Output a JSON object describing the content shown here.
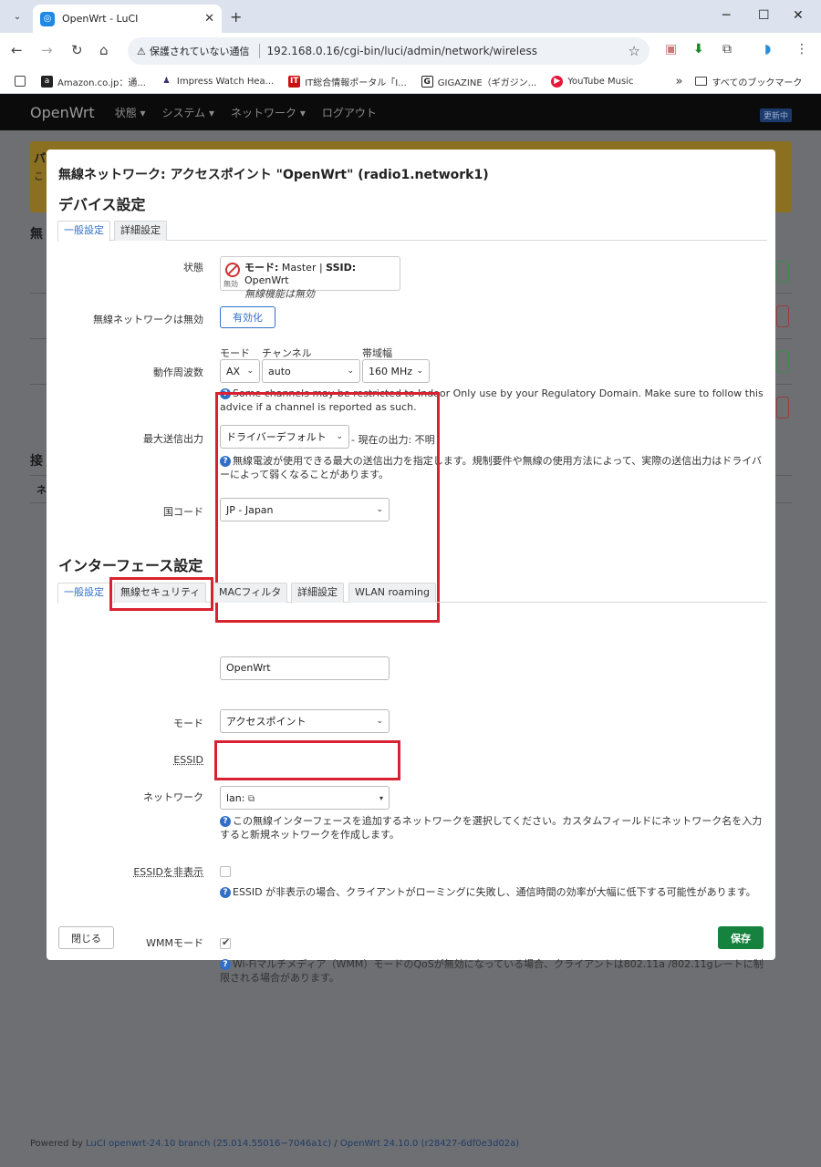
{
  "browser": {
    "tab_title": "OpenWrt - LuCI",
    "security": "保護されていない通信",
    "url": "192.168.0.16/cgi-bin/luci/admin/network/wireless",
    "bookmarks": [
      {
        "label": "Amazon.co.jp：通..."
      },
      {
        "label": "Impress Watch Hea..."
      },
      {
        "label": "IT総合情報ポータル「I..."
      },
      {
        "label": "GIGAZINE（ギガジン..."
      },
      {
        "label": "YouTube Music"
      }
    ],
    "all_bookmarks": "すべてのブックマーク"
  },
  "topnav": {
    "brand": "OpenWrt",
    "menus": [
      "状態 ▾",
      "システム ▾",
      "ネットワーク ▾",
      "ログアウト"
    ],
    "badge": "更新中"
  },
  "background": {
    "alert_title": "パ",
    "alert_sub": "こ",
    "heading_wireless": "無",
    "heading_assoc": "接",
    "assoc_col": "ネ"
  },
  "footer": {
    "powered": "Powered by ",
    "luci": "LuCI openwrt-24.10 branch (25.014.55016~7046a1c)",
    "sep": " / ",
    "os": "OpenWrt 24.10.0 (r28427-6df0e3d02a)"
  },
  "modal": {
    "title": "無線ネットワーク: アクセスポイント \"OpenWrt\" (radio1.network1)",
    "device_section": "デバイス設定",
    "device_tabs": [
      "一般設定",
      "詳細設定"
    ],
    "status_label": "状態",
    "status_mode_key": "モード:",
    "status_mode_val": " Master | ",
    "status_ssid_key": "SSID:",
    "status_ssid_val": " OpenWrt",
    "status_line2": "無線機能は無効",
    "status_icon_caption": "無効",
    "disabled_label": "無線ネットワークは無効",
    "enable_button": "有効化",
    "freq_label": "動作周波数",
    "freq_mode_label": "モード",
    "freq_channel_label": "チャンネル",
    "freq_width_label": "帯域幅",
    "freq_mode_value": "AX",
    "freq_channel_value": "auto",
    "freq_width_value": "160 MHz",
    "freq_help": "Some channels may be restricted to Indoor Only use by your Regulatory Domain. Make sure to follow this advice if a channel is reported as such.",
    "txpower_label": "最大送信出力",
    "txpower_value": "ドライバーデフォルト",
    "txpower_current": "- 現在の出力: 不明",
    "txpower_help": "無線電波が使用できる最大の送信出力を指定します。規制要件や無線の使用方法によって、実際の送信出力はドライバーによって弱くなることがあります。",
    "country_label": "国コード",
    "country_value": "JP - Japan",
    "iface_section": "インターフェース設定",
    "iface_tabs": [
      "一般設定",
      "無線セキュリティ",
      "MACフィルタ",
      "詳細設定",
      "WLAN roaming"
    ],
    "mode_label": "モード",
    "mode_value": "アクセスポイント",
    "essid_label": "ESSID",
    "essid_value": "OpenWrt",
    "network_label": "ネットワーク",
    "network_value": "lan:",
    "network_help": "この無線インターフェースを追加するネットワークを選択してください。カスタムフィールドにネットワーク名を入力すると新規ネットワークを作成します。",
    "hidden_label": "ESSIDを非表示",
    "hidden_help": "ESSID が非表示の場合、クライアントがローミングに失敗し、通信時間の効率が大幅に低下する可能性があります。",
    "wmm_label": "WMMモード",
    "wmm_help": "Wi-Fiマルチメディア（WMM）モードのQoSが無効になっている場合、クライアントは802.11a /802.11gレートに制限される場合があります。",
    "close_button": "閉じる",
    "save_button": "保存"
  },
  "colors": {
    "accent": "#3270c8",
    "save": "#15833d",
    "highlight": "#d92231"
  }
}
